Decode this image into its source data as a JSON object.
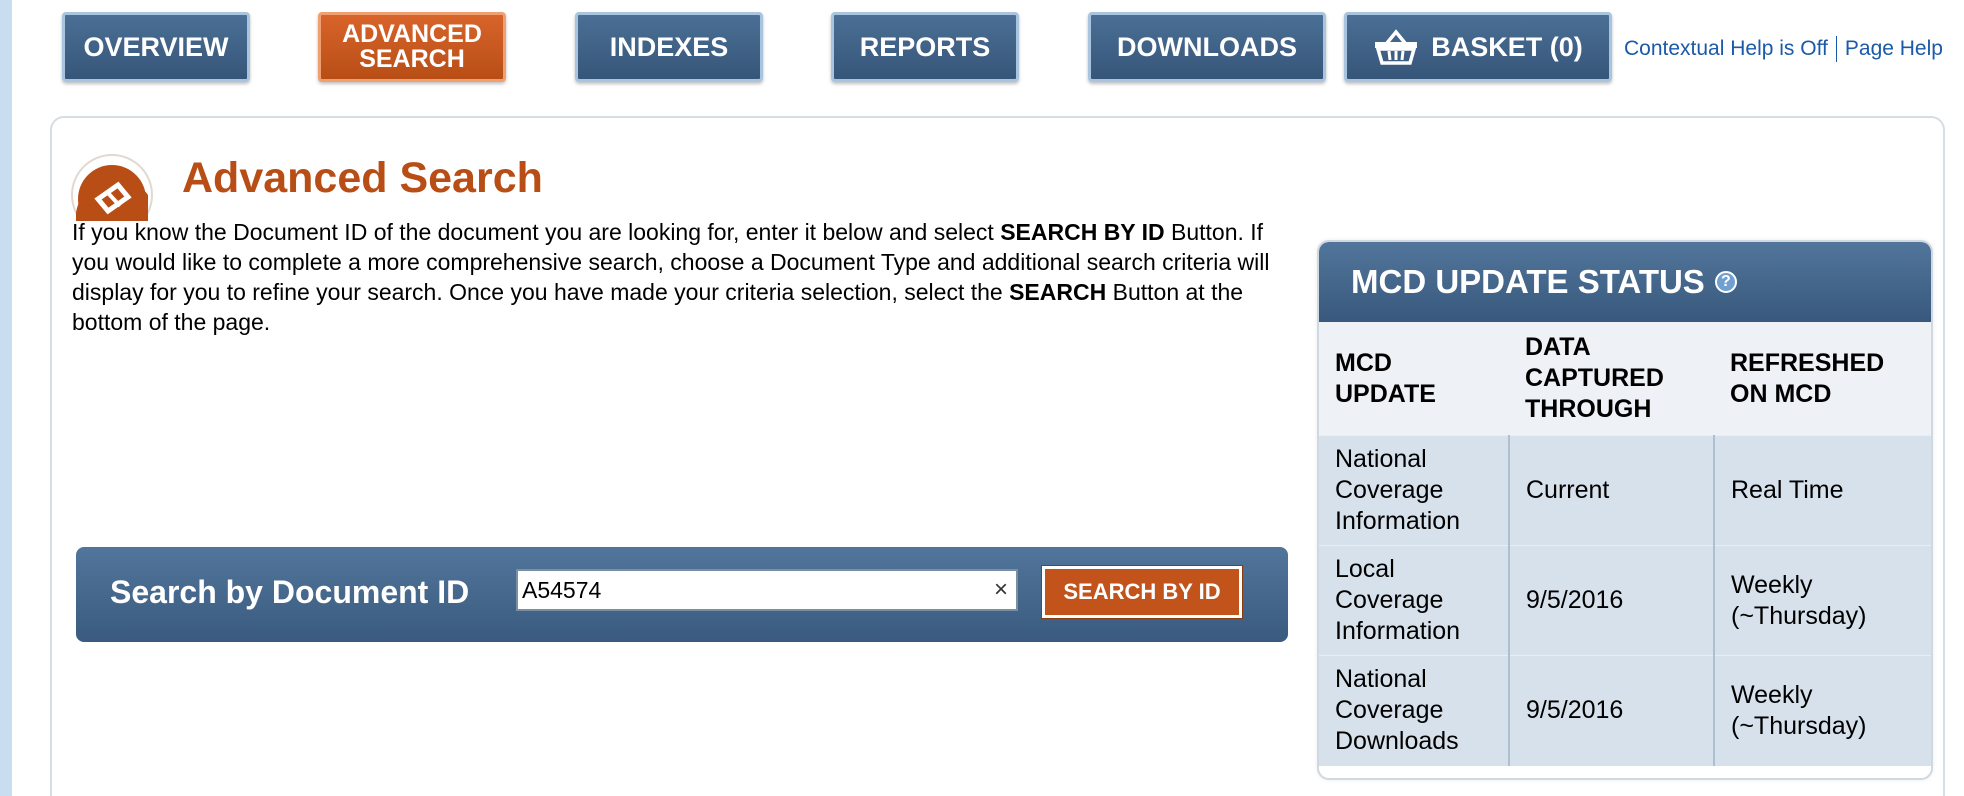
{
  "nav": {
    "tabs": [
      {
        "label": "OVERVIEW"
      },
      {
        "label": "ADVANCED\nSEARCH"
      },
      {
        "label": "INDEXES"
      },
      {
        "label": "REPORTS"
      },
      {
        "label": "DOWNLOADS"
      },
      {
        "label": "BASKET (0)"
      }
    ],
    "help_toggle": "Contextual Help is Off",
    "page_help": "Page Help"
  },
  "main": {
    "title": "Advanced Search",
    "intro": {
      "p1": "If you know the Document ID of the document you are looking for, enter it below and select ",
      "b1": "SEARCH BY ID",
      "p2": " Button. If you would like to complete a more comprehensive search, choose a Document Type and additional search criteria will display for you to refine your search. Once you have made your criteria selection, select the ",
      "b2": "SEARCH",
      "p3": " Button at the bottom of the page."
    },
    "search_by_id": {
      "label": "Search by Document ID",
      "value": "A54574",
      "clear": "×",
      "button": "SEARCH BY ID"
    }
  },
  "status": {
    "title": "MCD UPDATE STATUS",
    "help_icon": "?",
    "headers": [
      "MCD UPDATE",
      "DATA CAPTURED THROUGH",
      "REFRESHED ON MCD"
    ],
    "rows": [
      [
        "National Coverage Information",
        "Current",
        "Real Time"
      ],
      [
        "Local Coverage Information",
        "9/5/2016",
        "Weekly (~Thursday)"
      ],
      [
        "National Coverage Downloads",
        "9/5/2016",
        "Weekly (~Thursday)"
      ]
    ]
  },
  "colors": {
    "nav_blue": "#3f6187",
    "active_orange": "#c2531a",
    "title_orange": "#b84e16",
    "link_blue": "#1a5aa8",
    "table_cell_bg": "#d6e1eb"
  }
}
